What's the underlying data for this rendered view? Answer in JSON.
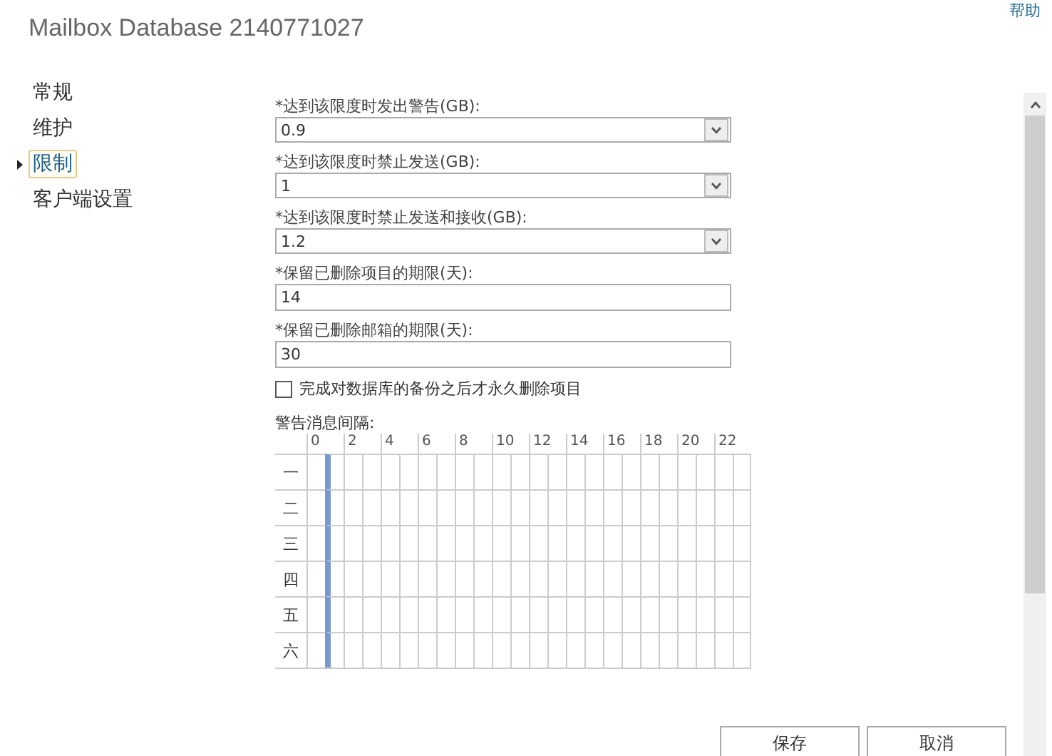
{
  "window": {
    "title": "Mailbox Database 2140771027",
    "help": "帮助"
  },
  "nav": [
    {
      "label": "常规",
      "selected": false
    },
    {
      "label": "维护",
      "selected": false
    },
    {
      "label": "限制",
      "selected": true
    },
    {
      "label": "客户端设置",
      "selected": false
    }
  ],
  "fields": [
    {
      "kind": "dropdown",
      "label": "*达到该限度时发出警告(GB):",
      "value": "0.9"
    },
    {
      "kind": "dropdown",
      "label": "*达到该限度时禁止发送(GB):",
      "value": "1"
    },
    {
      "kind": "dropdown",
      "label": "*达到该限度时禁止发送和接收(GB):",
      "value": "1.2"
    },
    {
      "kind": "text",
      "label": "*保留已删除项目的期限(天):",
      "value": "14"
    },
    {
      "kind": "text",
      "label": "*保留已删除邮箱的期限(天):",
      "value": "30"
    }
  ],
  "checkbox": {
    "label": "完成对数据库的备份之后才永久删除项目",
    "checked": false
  },
  "schedule": {
    "title": "警告消息间隔:",
    "columns": [
      {
        "label": "0",
        "marked": false
      },
      {
        "marked": true
      },
      {
        "label": "2",
        "marked": false
      },
      {
        "marked": false
      },
      {
        "label": "4",
        "marked": false
      },
      {
        "marked": false
      },
      {
        "label": "6",
        "marked": false
      },
      {
        "marked": false
      },
      {
        "label": "8",
        "marked": false
      },
      {
        "marked": false
      },
      {
        "label": "10",
        "marked": false
      },
      {
        "marked": false
      },
      {
        "label": "12",
        "marked": false
      },
      {
        "marked": false
      },
      {
        "label": "14",
        "marked": false
      },
      {
        "marked": false
      },
      {
        "label": "16",
        "marked": false
      },
      {
        "marked": false
      },
      {
        "label": "18",
        "marked": false
      },
      {
        "marked": false
      },
      {
        "label": "20",
        "marked": false
      },
      {
        "marked": false
      },
      {
        "label": "22",
        "marked": false
      },
      {
        "marked": false
      }
    ],
    "rows": [
      "一",
      "二",
      "三",
      "四",
      "五",
      "六"
    ]
  },
  "buttons": [
    "保存",
    "取消"
  ]
}
